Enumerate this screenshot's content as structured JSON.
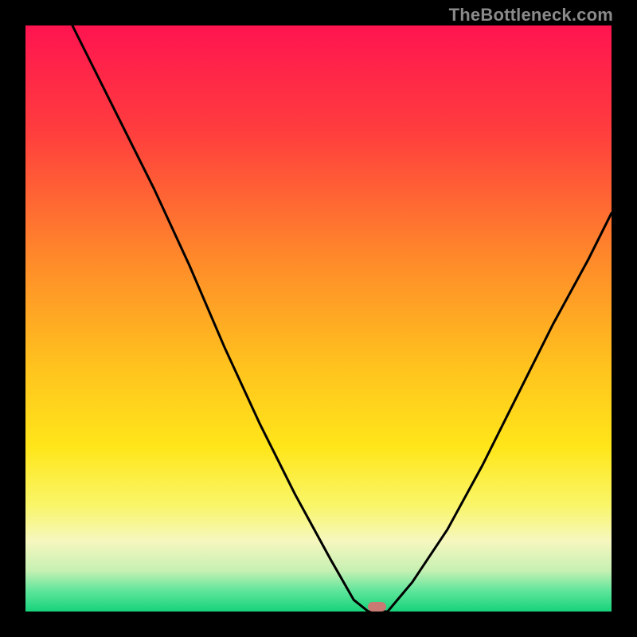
{
  "watermark": "TheBottleneck.com",
  "colors": {
    "frame": "#000000",
    "marker": "#c97a73",
    "curve": "#000000",
    "gradient_stops": [
      {
        "offset": 0.0,
        "color": "#ff1450"
      },
      {
        "offset": 0.18,
        "color": "#ff3d3e"
      },
      {
        "offset": 0.4,
        "color": "#ff8a2a"
      },
      {
        "offset": 0.58,
        "color": "#ffc21e"
      },
      {
        "offset": 0.72,
        "color": "#ffe61a"
      },
      {
        "offset": 0.82,
        "color": "#f9f66a"
      },
      {
        "offset": 0.88,
        "color": "#f6f7bf"
      },
      {
        "offset": 0.93,
        "color": "#c7f0b3"
      },
      {
        "offset": 0.965,
        "color": "#5ee59b"
      },
      {
        "offset": 1.0,
        "color": "#17d27a"
      }
    ]
  },
  "chart_data": {
    "type": "line",
    "title": "",
    "xlabel": "",
    "ylabel": "",
    "xlim": [
      0,
      100
    ],
    "ylim": [
      0,
      100
    ],
    "marker": {
      "x": 60,
      "y": 0,
      "w": 3.2,
      "h": 1.6
    },
    "series": [
      {
        "name": "left-branch",
        "x": [
          8,
          15,
          22,
          28,
          34,
          40,
          46,
          52,
          56,
          58.5
        ],
        "y": [
          100,
          86,
          72,
          59,
          45,
          32,
          20,
          9,
          2,
          0
        ]
      },
      {
        "name": "valley-floor",
        "x": [
          58.5,
          61.8
        ],
        "y": [
          0,
          0
        ]
      },
      {
        "name": "right-branch",
        "x": [
          61.8,
          66,
          72,
          78,
          84,
          90,
          96,
          100
        ],
        "y": [
          0,
          5,
          14,
          25,
          37,
          49,
          60,
          68
        ]
      }
    ]
  }
}
